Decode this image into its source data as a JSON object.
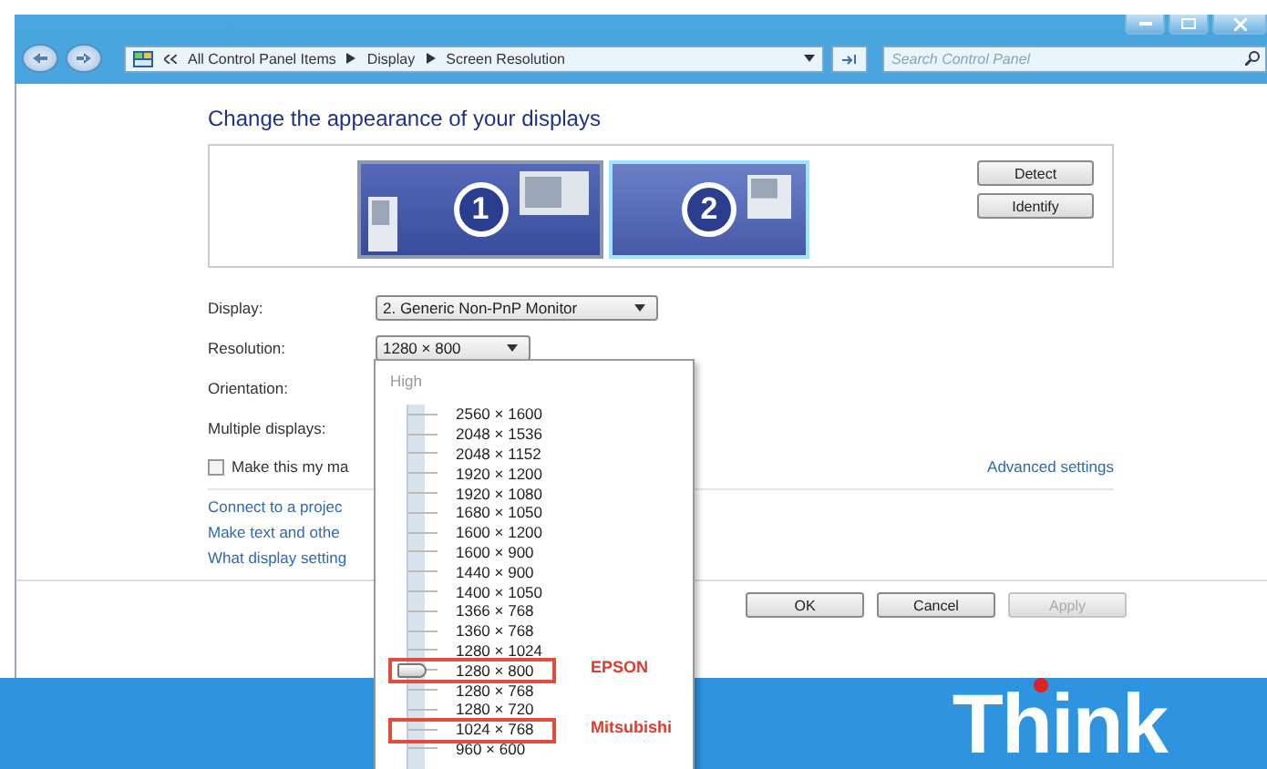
{
  "window": {
    "address": {
      "path": [
        "All Control Panel Items",
        "Display",
        "Screen Resolution"
      ]
    },
    "search": {
      "placeholder": "Search Control Panel"
    }
  },
  "heading": "Change the appearance of your displays",
  "monitors": [
    {
      "number": "1",
      "selected": false
    },
    {
      "number": "2",
      "selected": true
    }
  ],
  "monitor_buttons": [
    "Detect",
    "Identify"
  ],
  "settings": [
    {
      "label": "Display:",
      "value": "2. Generic Non-PnP Monitor"
    },
    {
      "label": "Resolution:",
      "value": "1280 × 800"
    },
    {
      "label": "Orientation:"
    },
    {
      "label": "Multiple displays:"
    }
  ],
  "main_display_checkbox": {
    "label": "Make this my ma",
    "checked": false
  },
  "advanced_link": "Advanced settings",
  "links": [
    "Connect to a projec",
    "Make text and othe",
    "What display setting"
  ],
  "dialog_buttons": [
    {
      "label": "OK",
      "disabled": false
    },
    {
      "label": "Cancel",
      "disabled": false
    },
    {
      "label": "Apply",
      "disabled": true
    }
  ],
  "resolution_list": {
    "header": "High",
    "items": [
      {
        "label": "2560 × 1600",
        "selected": false
      },
      {
        "label": "2048 × 1536",
        "selected": false
      },
      {
        "label": "2048 × 1152",
        "selected": false
      },
      {
        "label": "1920 × 1200",
        "selected": false
      },
      {
        "label": "1920 × 1080",
        "selected": false
      },
      {
        "label": "1680 × 1050",
        "selected": false
      },
      {
        "label": "1600 × 1200",
        "selected": false
      },
      {
        "label": "1600 × 900",
        "selected": false
      },
      {
        "label": "1440 × 900",
        "selected": false
      },
      {
        "label": "1400 × 1050",
        "selected": false
      },
      {
        "label": "1366 × 768",
        "selected": false
      },
      {
        "label": "1360 × 768",
        "selected": false
      },
      {
        "label": "1280 × 1024",
        "selected": false
      },
      {
        "label": "1280 × 800",
        "selected": true,
        "annotation": "EPSON"
      },
      {
        "label": "1280 × 768",
        "selected": false
      },
      {
        "label": "1280 × 720",
        "selected": false
      },
      {
        "label": "1024 × 768",
        "selected": false,
        "annotation": "Mitsubishi"
      },
      {
        "label": "960 × 600",
        "selected": false
      }
    ]
  },
  "desktop": {
    "logo": "Think"
  }
}
